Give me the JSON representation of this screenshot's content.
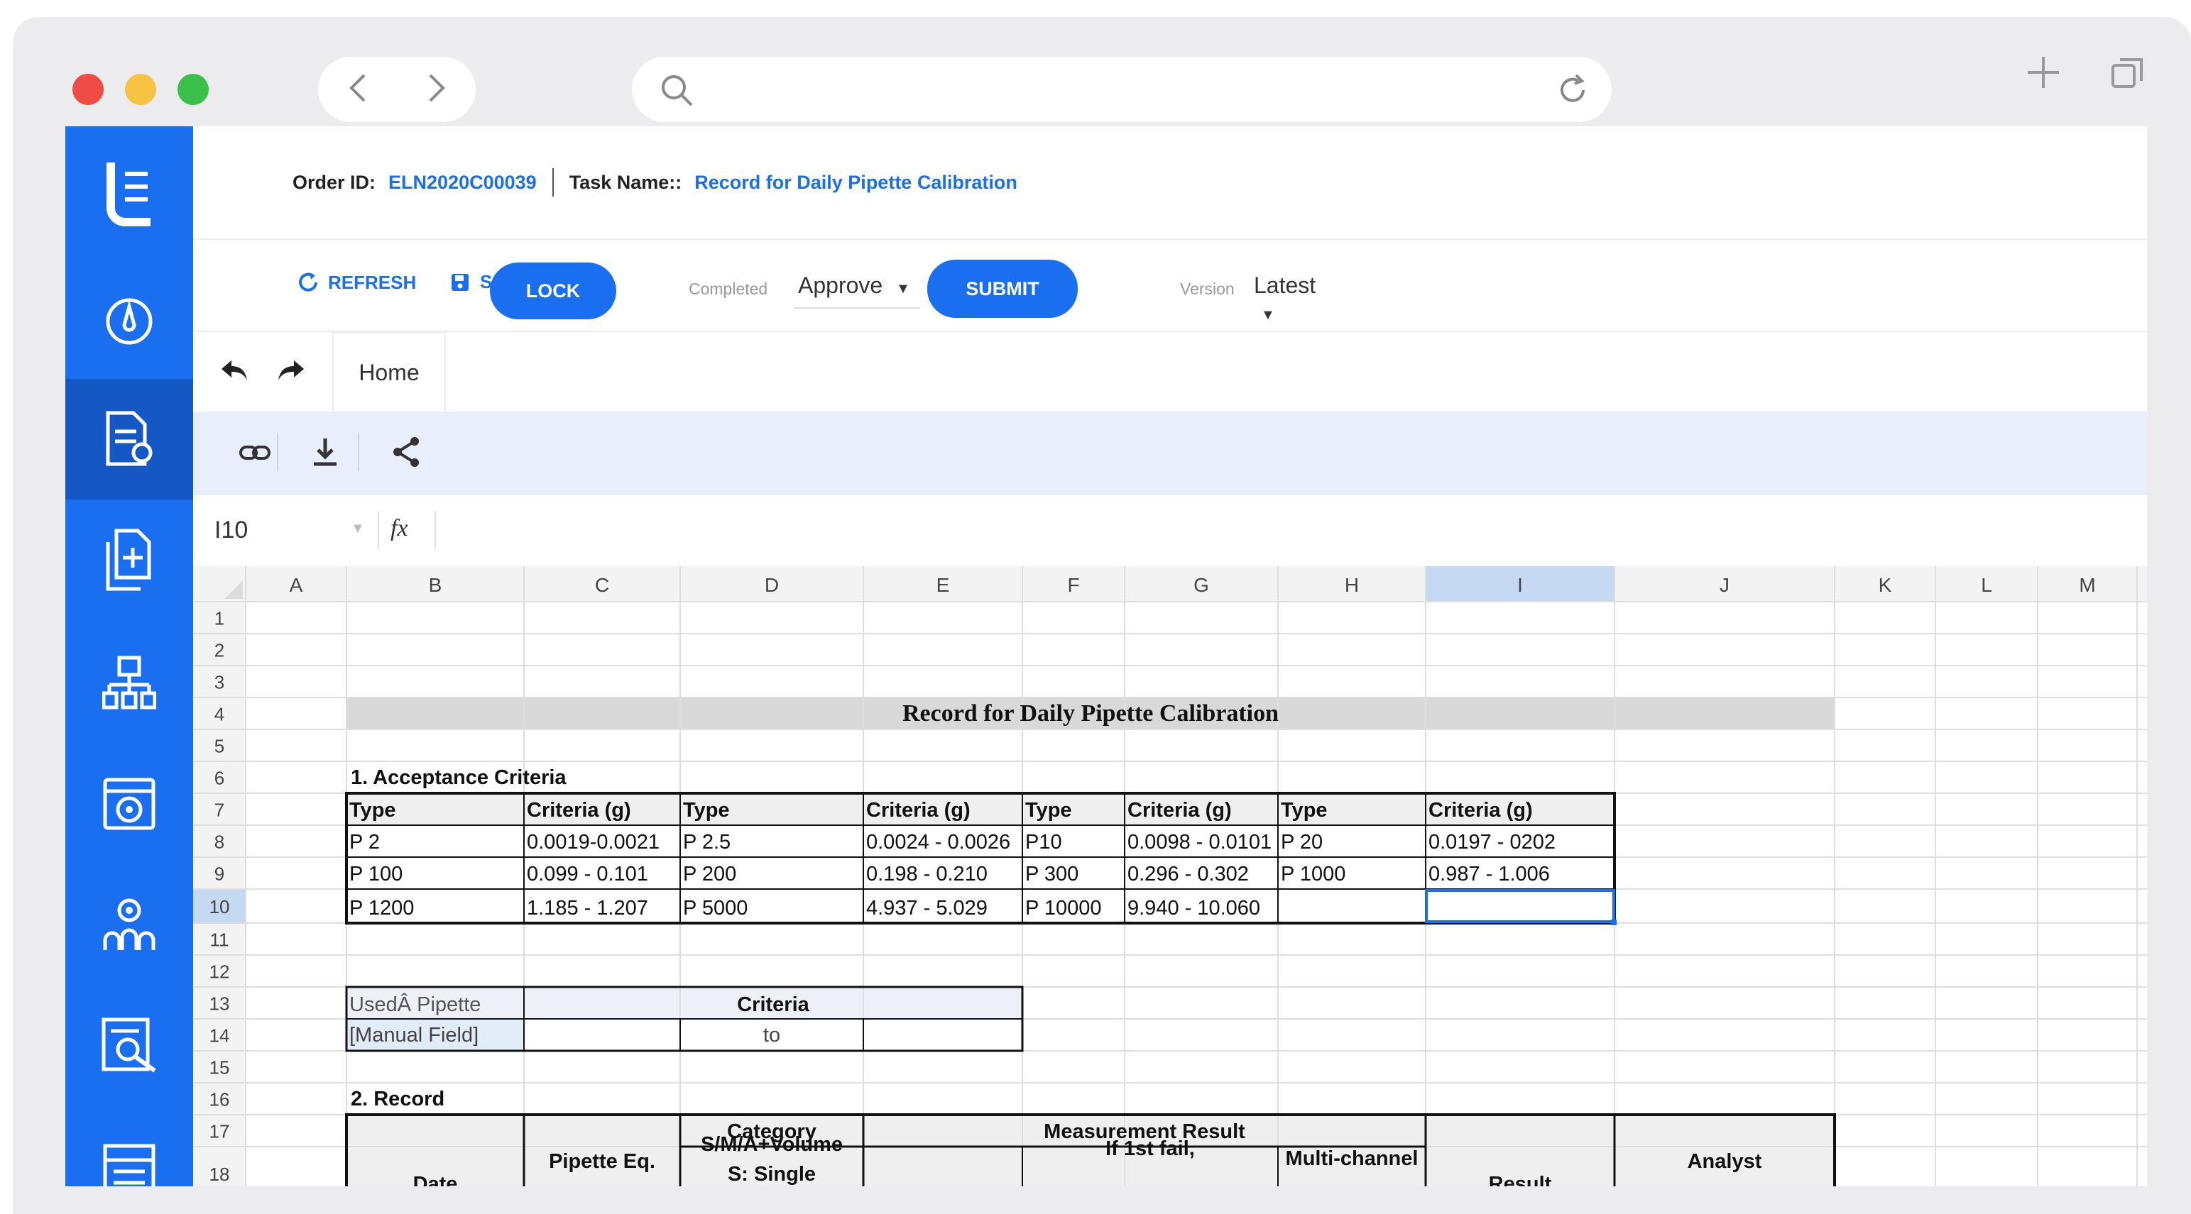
{
  "browser": {
    "traffic_colors": [
      "#ee4c44",
      "#f6c342",
      "#3cc04c"
    ],
    "back_icon": "chevron-left-icon",
    "forward_icon": "chevron-right-icon",
    "search_icon": "search-icon",
    "reload_icon": "reload-icon",
    "new_tab_icon": "plus-icon",
    "tabs_icon": "tabs-icon"
  },
  "colors": {
    "accent": "#1a6ff0",
    "sidebar": "#1a6ff0",
    "sidebar_active": "#1657c6"
  },
  "sidebar": {
    "items": [
      {
        "icon": "logo-icon"
      },
      {
        "icon": "dashboard-gauge-icon"
      },
      {
        "icon": "document-edit-icon",
        "active": true
      },
      {
        "icon": "document-add-icon"
      },
      {
        "icon": "hierarchy-icon"
      },
      {
        "icon": "settings-window-icon"
      },
      {
        "icon": "team-settings-icon"
      },
      {
        "icon": "search-document-icon"
      },
      {
        "icon": "list-icon"
      }
    ]
  },
  "header": {
    "order_label": "Order ID:",
    "order_value": "ELN2020C00039",
    "task_label": "Task Name::",
    "task_value": "Record for Daily Pipette Calibration"
  },
  "toolbar": {
    "refresh_label": "REFRESH",
    "save_label": "SAVE",
    "lock_label": "LOCK",
    "completed_label": "Completed",
    "approve_value": "Approve",
    "submit_label": "SUBMIT",
    "version_label": "Version",
    "version_value": "Latest",
    "close_icon": "close-icon"
  },
  "tabs": {
    "home_label": "Home"
  },
  "ribbon": {
    "icons": [
      "link-icon",
      "download-icon",
      "share-icon"
    ]
  },
  "formula_bar": {
    "cell_ref": "I10",
    "fx": "fx",
    "formula": ""
  },
  "sheet": {
    "columns": [
      "A",
      "B",
      "C",
      "D",
      "E",
      "F",
      "G",
      "H",
      "I",
      "J",
      "K",
      "L",
      "M"
    ],
    "selected_column": "I",
    "selected_row": 10,
    "rows": [
      "1",
      "2",
      "3",
      "4",
      "5",
      "6",
      "7",
      "8",
      "9",
      "10",
      "11",
      "12",
      "13",
      "14",
      "15",
      "16",
      "17",
      "18"
    ],
    "title": "Record for Daily Pipette Calibration",
    "section1": "1.  Acceptance Criteria",
    "criteria_table": [
      [
        "Type",
        "Criteria (g)",
        "Type",
        "Criteria (g)",
        "Type",
        "Criteria (g)",
        "Type",
        "Criteria (g)"
      ],
      [
        "P 2",
        "0.0019-0.0021",
        "P 2.5",
        "0.0024 - 0.0026",
        "P10",
        "0.0098 - 0.0101",
        "P 20",
        "0.0197 - 0202"
      ],
      [
        "P 100",
        "0.099 - 0.101",
        "P 200",
        "0.198 - 0.210",
        "P 300",
        "0.296 - 0.302",
        "P 1000",
        "0.987 - 1.006"
      ],
      [
        "P 1200",
        "1.185 - 1.207",
        "P 5000",
        "4.937 - 5.029",
        "P 10000",
        "9.940 - 10.060",
        "",
        ""
      ]
    ],
    "used_pipette_label": "UsedÂ  Pipette",
    "criteria_header": "Criteria",
    "manual_field": "[Manual Field]",
    "to_label": "to",
    "section2": "2.  Record",
    "record_headers": {
      "date": "Date",
      "pipette_eq": "Pipette Eq.",
      "category": "Category",
      "category_sub1": "S/M/A+Volume",
      "category_sub2": "S: Single",
      "measurement_result": "Measurement Result",
      "if_first_fail": "If 1st fail,",
      "multi_channel": "Multi-channel",
      "result": "Result",
      "analyst": "Analyst"
    }
  }
}
